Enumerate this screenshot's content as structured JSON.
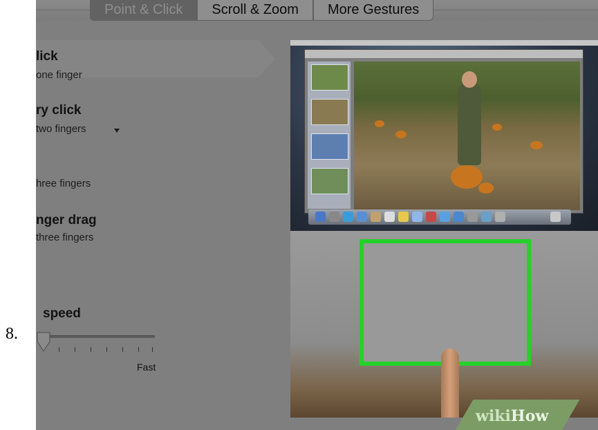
{
  "step_number": "8.",
  "tabs": [
    {
      "label": "Point & Click",
      "active": true
    },
    {
      "label": "Scroll & Zoom",
      "active": false
    },
    {
      "label": "More Gestures",
      "active": false
    }
  ],
  "options": [
    {
      "title": "lick",
      "subtitle": "one finger",
      "selected": true
    },
    {
      "title": "ry click",
      "subtitle": "two fingers",
      "has_dropdown": true
    },
    {
      "title": "",
      "subtitle": "hree fingers"
    },
    {
      "title": "nger drag",
      "subtitle": "three fingers"
    }
  ],
  "speed": {
    "title": "speed",
    "max_label": "Fast",
    "level": 0.0
  },
  "preview": {
    "highlight_color": "#25d12a",
    "content": "trackpad-demo"
  },
  "watermark": {
    "part1": "wiki",
    "part2": "How"
  }
}
